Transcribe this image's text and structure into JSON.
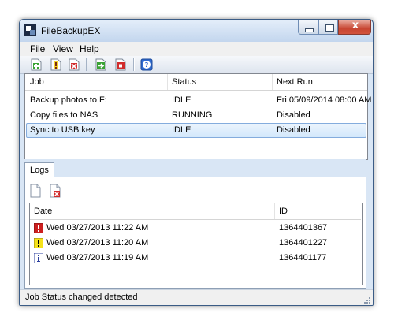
{
  "window": {
    "title": "FileBackupEX"
  },
  "window_controls": {
    "close_glyph": "x"
  },
  "menu": {
    "file": "File",
    "view": "View",
    "help": "Help"
  },
  "toolbar": {
    "icons": [
      "add-job-icon",
      "job-info-icon",
      "delete-job-icon",
      "run-job-icon",
      "stop-job-icon",
      "help-icon"
    ]
  },
  "jobs": {
    "headers": {
      "job": "Job",
      "status": "Status",
      "next_run": "Next Run"
    },
    "rows": [
      {
        "job": "Backup photos to F:",
        "status": "IDLE",
        "next_run": "Fri 05/09/2014 08:00 AM",
        "selected": false
      },
      {
        "job": "Copy files to NAS",
        "status": "RUNNING",
        "next_run": "Disabled",
        "selected": false
      },
      {
        "job": "Sync to USB key",
        "status": "IDLE",
        "next_run": "Disabled",
        "selected": true
      }
    ]
  },
  "logs": {
    "tab_label": "Logs",
    "headers": {
      "date": "Date",
      "id": "ID"
    },
    "rows": [
      {
        "icon": "error-icon",
        "date": "Wed 03/27/2013 11:22 AM",
        "id": "1364401367"
      },
      {
        "icon": "warning-icon",
        "date": "Wed 03/27/2013 11:20 AM",
        "id": "1364401227"
      },
      {
        "icon": "info-icon",
        "date": "Wed 03/27/2013 11:19 AM",
        "id": "1364401177"
      }
    ]
  },
  "status_bar": {
    "text": "Job Status changed detected"
  },
  "colors": {
    "selection": "#d3e8fb",
    "selection_border": "#84acdd",
    "error": "#cc1f1f",
    "warning": "#f5e21a",
    "info": "#2b3f9e"
  }
}
